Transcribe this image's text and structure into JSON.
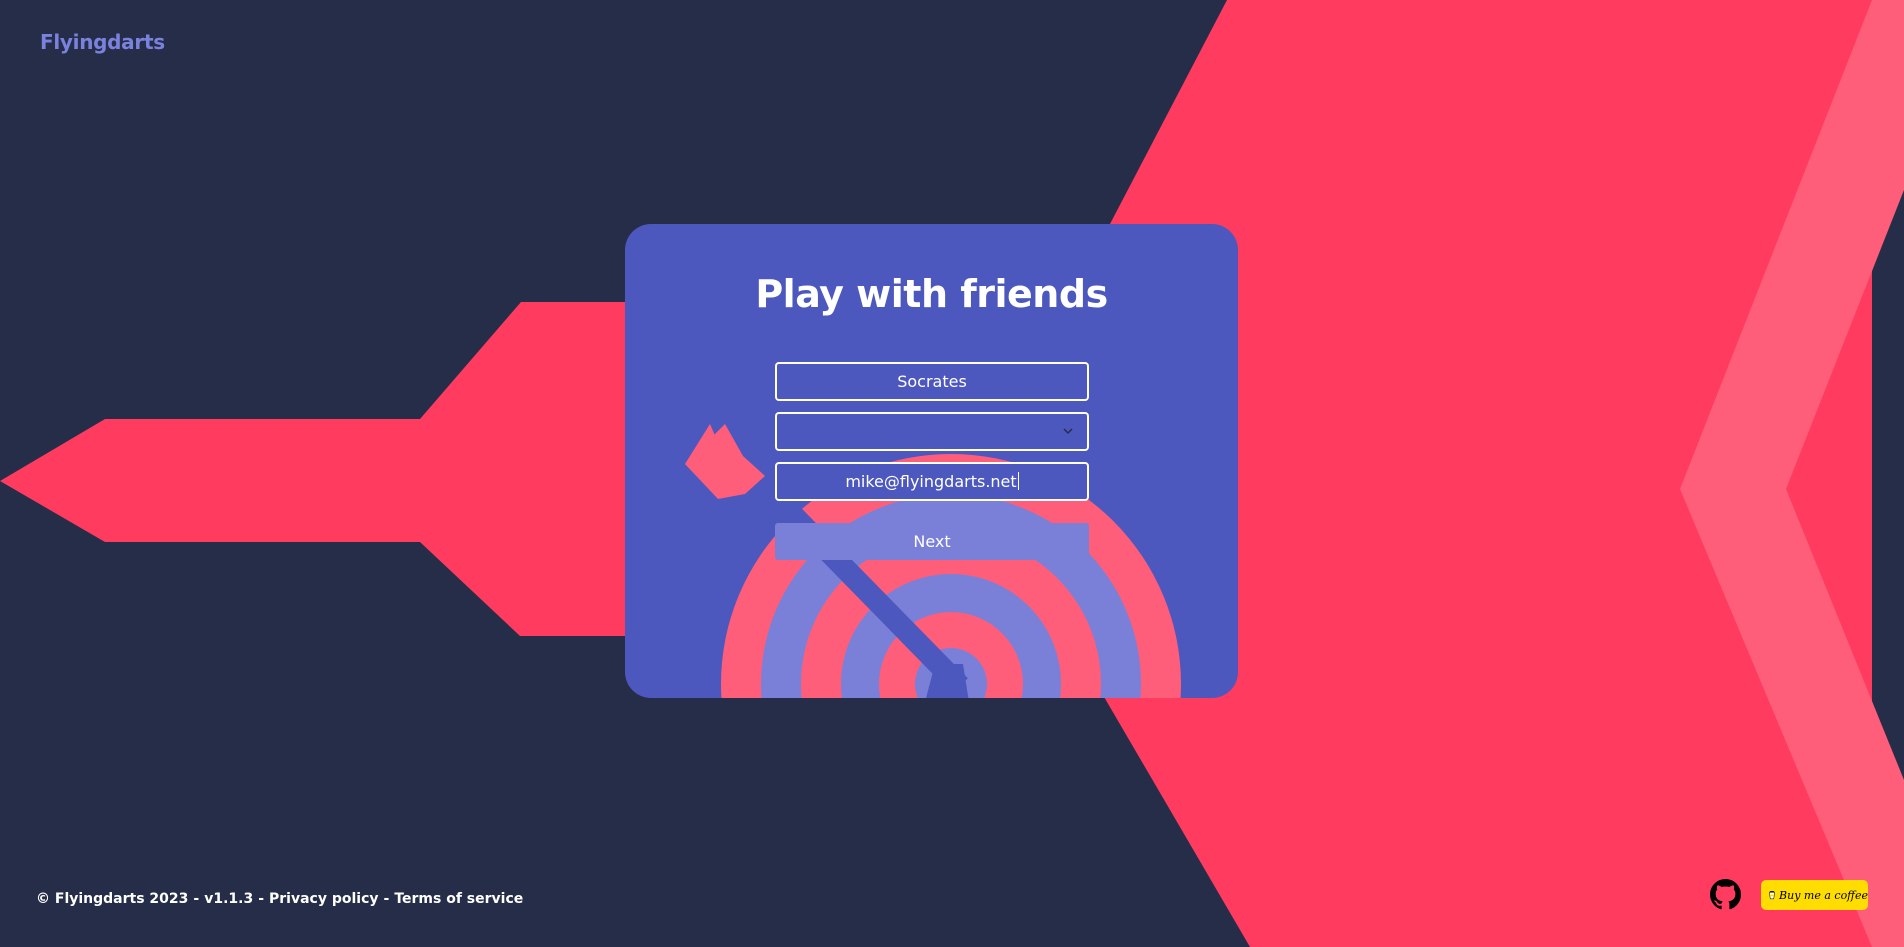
{
  "app": {
    "brand": "Flyingdarts"
  },
  "card": {
    "title": "Play with friends",
    "name_value": "Socrates",
    "select_value": "",
    "email_value": "mike@flyingdarts.net",
    "next_label": "Next"
  },
  "footer": {
    "copyright": "© Flyingdarts 2023",
    "version": "v1.1.3",
    "privacy": "Privacy policy",
    "terms": "Terms of service",
    "separator": "-",
    "github_icon": "github-icon",
    "coffee_label": "Buy me a coffee"
  },
  "colors": {
    "background": "#262d48",
    "accent_red": "#ff3b60",
    "accent_pink": "#fe5e7a",
    "card": "#4c58be",
    "brand": "#7b82de",
    "coffee_button": "#ffdd00"
  }
}
